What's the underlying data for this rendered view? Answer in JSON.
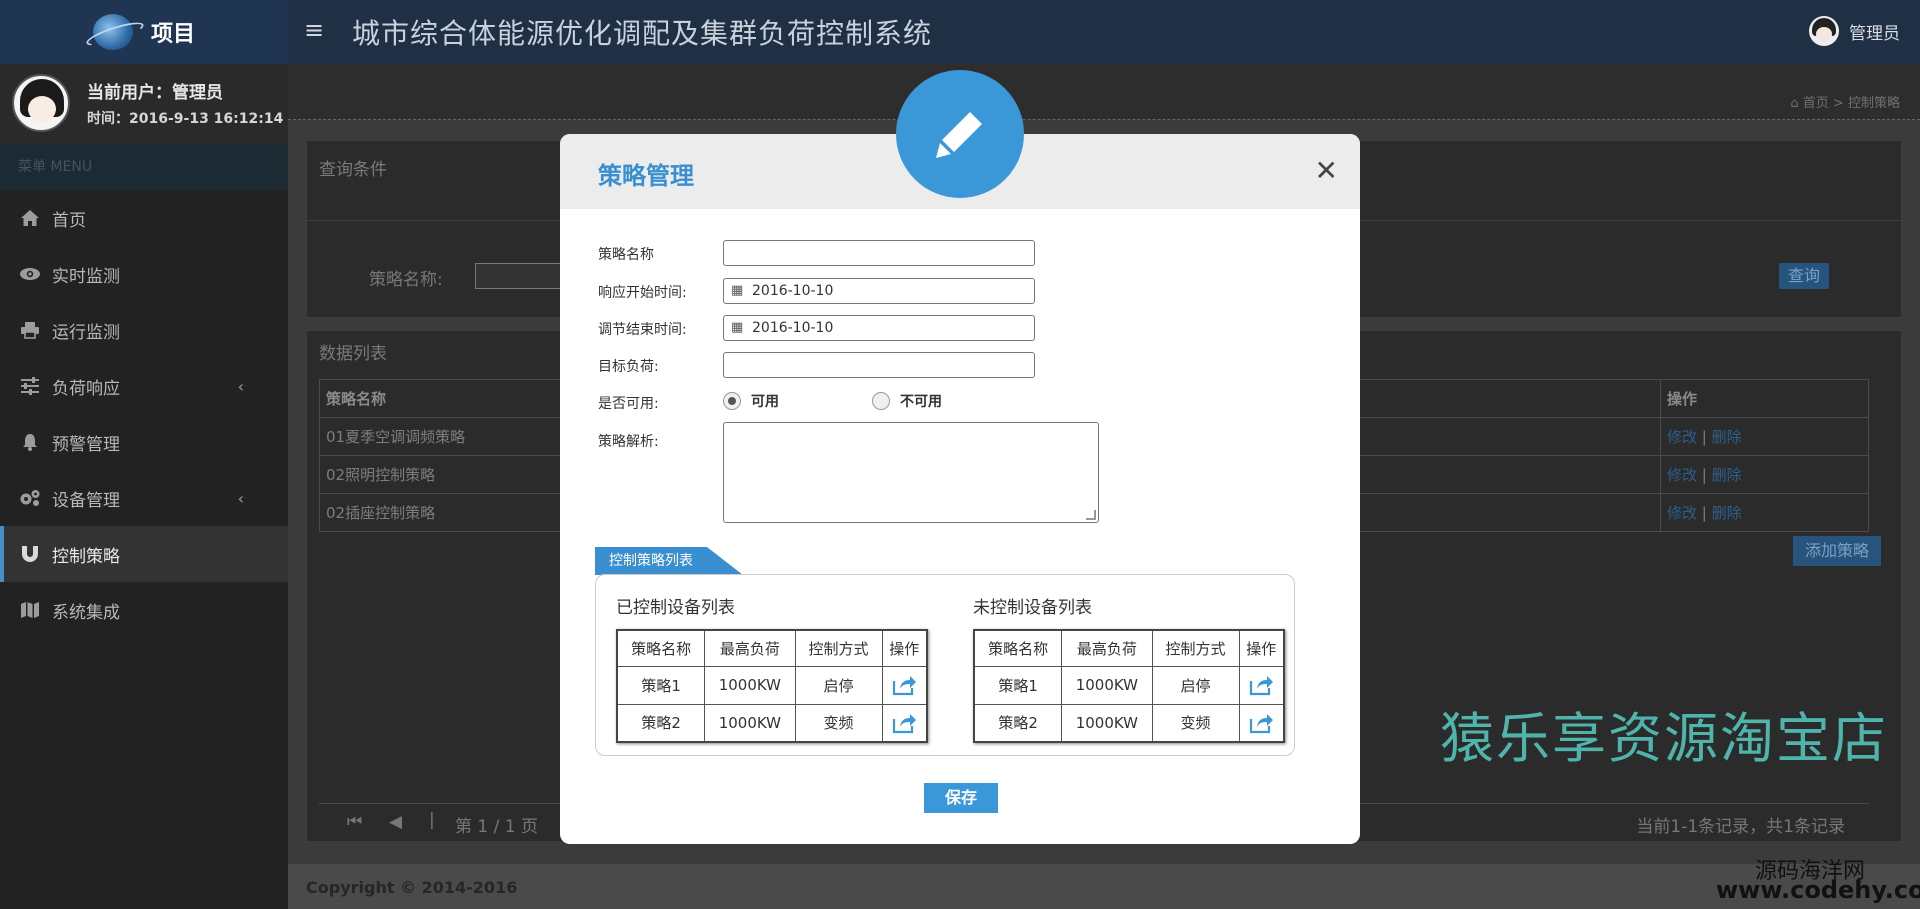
{
  "topbar": {
    "brand": "项目",
    "menu_toggle": "≡",
    "system_title": "城市综合体能源优化调配及集群负荷控制系统",
    "admin": "管理员"
  },
  "sidebar": {
    "user_label": "当前用户：管理员",
    "time_label": "时间：2016-9-13 16:12:14",
    "menu_head": "菜单 MENU",
    "items": [
      {
        "label": "首页",
        "icon": "home-icon"
      },
      {
        "label": "实时监测",
        "icon": "eye-icon"
      },
      {
        "label": "运行监测",
        "icon": "printer-icon"
      },
      {
        "label": "负荷响应",
        "icon": "sliders-icon"
      },
      {
        "label": "预警管理",
        "icon": "bell-icon"
      },
      {
        "label": "设备管理",
        "icon": "gears-icon"
      },
      {
        "label": "控制策略",
        "icon": "magnet-icon"
      },
      {
        "label": "系统集成",
        "icon": "map-icon"
      }
    ]
  },
  "breadcrumb": {
    "home": "首页",
    "sep": ">",
    "current": "控制策略"
  },
  "query": {
    "title": "查询条件",
    "name_label": "策略名称:",
    "button": "查询"
  },
  "list": {
    "title": "数据列表",
    "columns": [
      "策略名称",
      "操作"
    ],
    "rows": [
      {
        "name": "01夏季空调调频策略",
        "edit": "修改",
        "sep": "|",
        "del": "删除"
      },
      {
        "name": "02照明控制策略",
        "edit": "修改",
        "sep": "|",
        "del": "删除"
      },
      {
        "name": "02插座控制策略",
        "edit": "修改",
        "sep": "|",
        "del": "删除"
      }
    ],
    "add_button": "添加策略",
    "pager": {
      "first": "⏮",
      "prev": "◀",
      "sep": "|",
      "info": "第 1 / 1 页",
      "count": "当前1-1条记录，共1条记录"
    }
  },
  "footer": "Copyright © 2014-2016",
  "modal": {
    "title": "策略管理",
    "close": "✕",
    "fields": {
      "name_label": "策略名称",
      "name_value": "",
      "start_label": "响应开始时间:",
      "start_value": "2016-10-10",
      "end_label": "调节结束时间:",
      "end_value": "2016-10-10",
      "target_label": "目标负荷:",
      "target_value": "",
      "enabled_label": "是否可用:",
      "enabled_options": [
        "可用",
        "不可用"
      ],
      "enabled_selected": "可用",
      "analysis_label": "策略解析:"
    },
    "section_tab": "控制策略列表",
    "controlled": {
      "title": "已控制设备列表",
      "columns": [
        "策略名称",
        "最高负荷",
        "控制方式",
        "操作"
      ],
      "rows": [
        {
          "name": "策略1",
          "load": "1000KW",
          "mode": "启停"
        },
        {
          "name": "策略2",
          "load": "1000KW",
          "mode": "变频"
        }
      ]
    },
    "uncontrolled": {
      "title": "未控制设备列表",
      "columns": [
        "策略名称",
        "最高负荷",
        "控制方式",
        "操作"
      ],
      "rows": [
        {
          "name": "策略1",
          "load": "1000KW",
          "mode": "启停"
        },
        {
          "name": "策略2",
          "load": "1000KW",
          "mode": "变频"
        }
      ]
    },
    "save_button": "保存"
  },
  "watermarks": {
    "shop": "猿乐享资源淘宝店",
    "site_cn": "源码海洋网",
    "site_url": "www.codehy.com"
  },
  "colors": {
    "accent": "#3a98d8",
    "topbar": "#1f2f44",
    "sidebar": "#222222",
    "watermark": "#4fb5ac"
  }
}
